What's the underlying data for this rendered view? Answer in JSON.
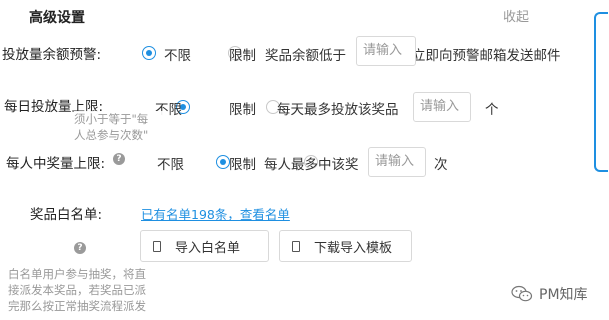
{
  "section": {
    "title": "高级设置",
    "collapse_label": "收起"
  },
  "balance_alert": {
    "label": "投放量余额预警:",
    "option_unlimited": "不限",
    "option_limited": "限制",
    "text_before": "奖品余额低于",
    "input_placeholder": "请输入",
    "text_after": "立即向预警邮箱发送邮件"
  },
  "daily_limit": {
    "label": "每日投放量上限:",
    "option_unlimited": "不限",
    "option_limited": "限制",
    "text_before": "每天最多投放该奖品",
    "input_placeholder": "请输入",
    "unit": "个",
    "tooltip_line1": "须小于等于\"每",
    "tooltip_line2": "人总参与次数\""
  },
  "per_user_limit": {
    "label": "每人中奖量上限:",
    "option_unlimited": "不限",
    "option_limited": "限制",
    "text_before": "每人最多中该奖",
    "input_placeholder": "请输入",
    "unit": "次"
  },
  "whitelist": {
    "label": "奖品白名单:",
    "link_text": "已有名单198条，查看名单",
    "import_button": "导入白名单",
    "download_button": "下载导入模板",
    "tooltip_line1": "白名单用户参与抽奖，将直",
    "tooltip_line2": "接派发本奖品，若奖品已派",
    "tooltip_line3": "完那么按正常抽奖流程派发"
  },
  "watermark": {
    "text": "PM知库"
  },
  "colors": {
    "accent": "#1e8fe1"
  }
}
